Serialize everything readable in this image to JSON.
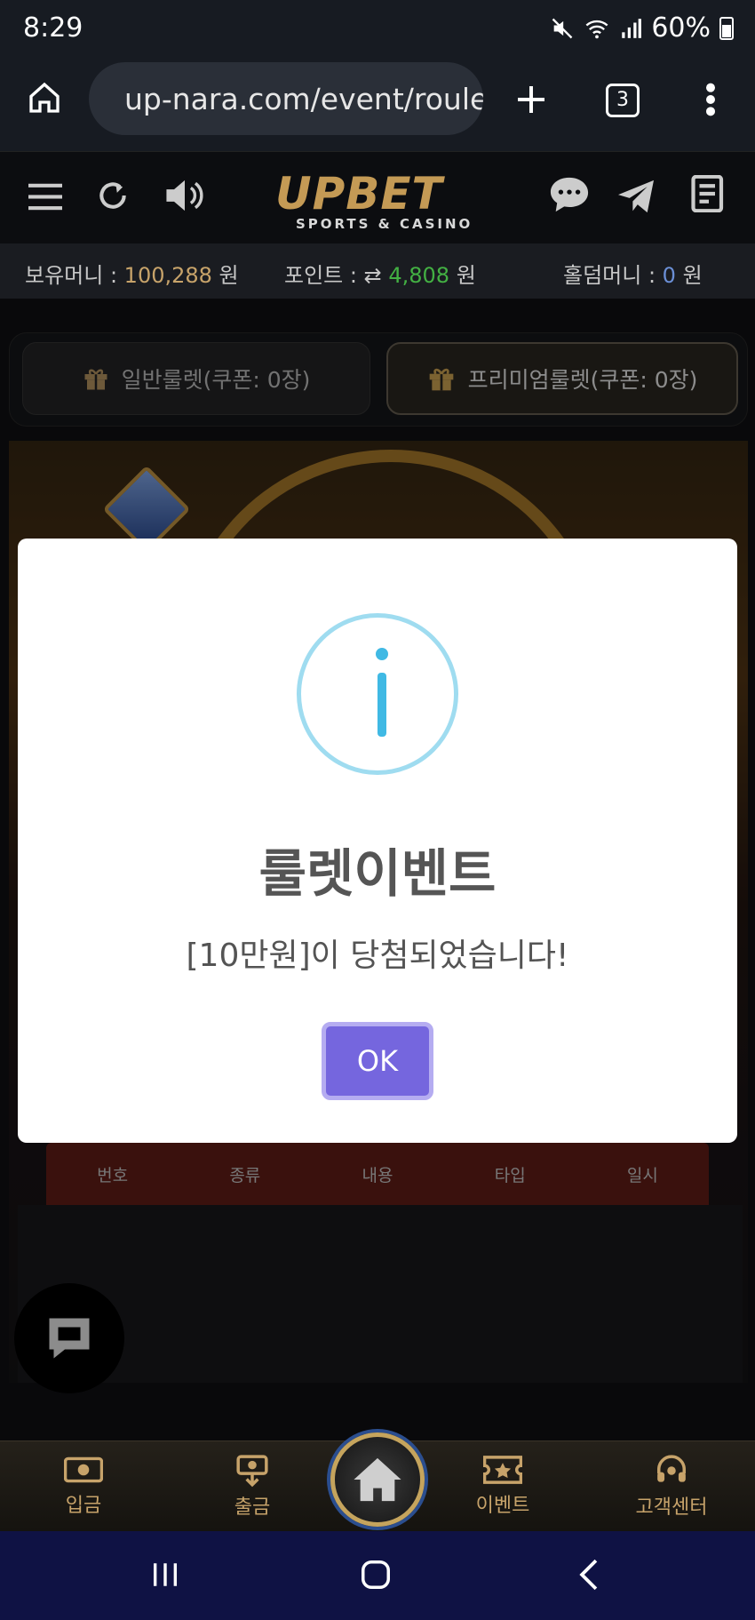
{
  "status_bar": {
    "time": "8:29",
    "battery": "60%"
  },
  "browser": {
    "url": "up-nara.com/event/roule",
    "tab_count": "3"
  },
  "header": {
    "logo": "UPBET",
    "logo_sub": "SPORTS & CASINO"
  },
  "balance": {
    "money_label": "보유머니 : ",
    "money_value": "100,288",
    "money_unit": " 원",
    "point_label": "포인트 : ",
    "point_icon": "⇄",
    "point_value": "4,808",
    "point_unit": " 원",
    "holdem_label": "홀덤머니 : ",
    "holdem_value": "0",
    "holdem_unit": " 원"
  },
  "roulette_tabs": [
    {
      "label": "일반룰렛(쿠폰: 0장)"
    },
    {
      "label": "프리미엄룰렛(쿠폰: 0장)"
    }
  ],
  "list_header": [
    "번호",
    "종류",
    "내용",
    "타입",
    "일시"
  ],
  "modal": {
    "title": "룰렛이벤트",
    "message": "[10만원]이 당첨되었습니다!",
    "ok_label": "OK"
  },
  "bottom_nav": [
    {
      "label": "입금",
      "icon": "deposit-icon"
    },
    {
      "label": "출금",
      "icon": "withdraw-icon"
    },
    {
      "label": "",
      "icon": "home-icon"
    },
    {
      "label": "이벤트",
      "icon": "ticket-icon"
    },
    {
      "label": "고객센터",
      "icon": "headset-icon"
    }
  ],
  "colors": {
    "accent_gold": "#c7a36a",
    "point_green": "#43b043",
    "ok_button": "#7566de",
    "info_blue": "#40b9e4",
    "list_header_red": "#6a2019"
  }
}
